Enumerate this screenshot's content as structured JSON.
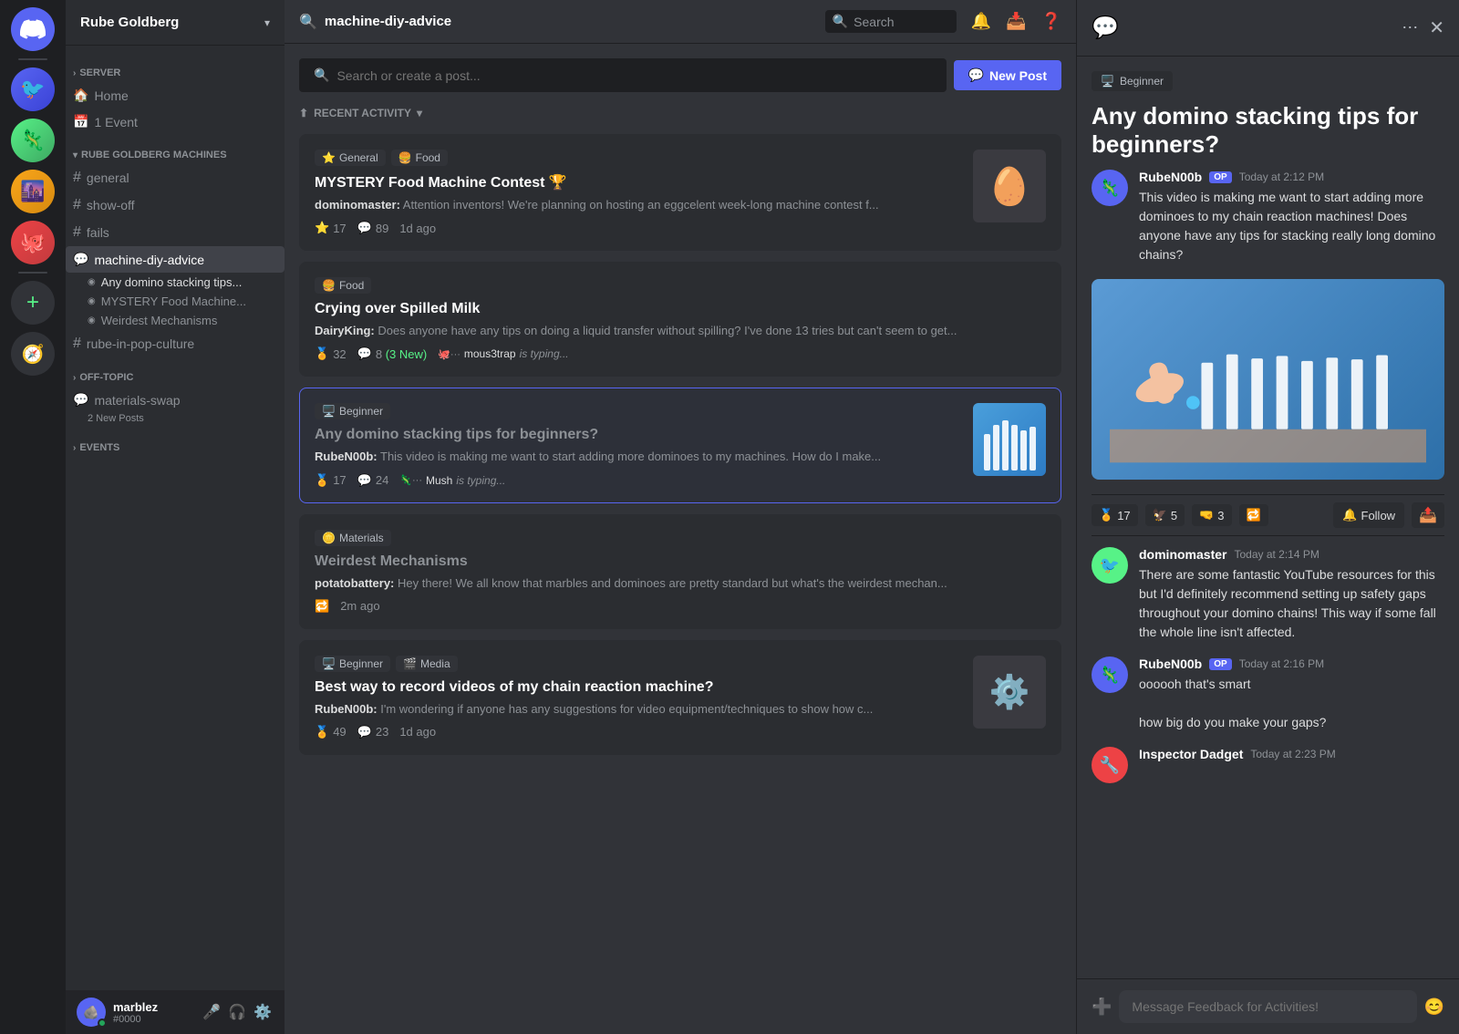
{
  "app": {
    "server_name": "Rube Goldberg",
    "channel_name": "machine-diy-advice"
  },
  "icon_bar": {
    "discord_icon": "💬",
    "add_server_icon": "+",
    "compass_icon": "🧭",
    "servers": [
      {
        "emoji": "🐦",
        "color": "#5865f2"
      },
      {
        "emoji": "🦎",
        "color": "#57f287"
      },
      {
        "emoji": "🌆",
        "color": "#faa61a"
      },
      {
        "emoji": "🐙",
        "color": "#ed4245"
      }
    ]
  },
  "sidebar": {
    "server_name": "Rube Goldberg",
    "sections": {
      "server_label": "SERVER",
      "items": [
        {
          "icon": "🏠",
          "label": "Home",
          "type": "nav"
        },
        {
          "icon": "📅",
          "label": "1 Event",
          "type": "nav"
        }
      ]
    },
    "category_machines": "RUBE GOLDBERG MACHINES",
    "channels": [
      {
        "name": "general",
        "type": "hash"
      },
      {
        "name": "show-off",
        "type": "hash"
      },
      {
        "name": "fails",
        "type": "hash"
      },
      {
        "name": "machine-diy-advice",
        "type": "bubble",
        "active": true
      }
    ],
    "sub_channels": [
      {
        "name": "Any domino stacking tips...",
        "active": true
      },
      {
        "name": "MYSTERY Food Machine...",
        "active": false
      },
      {
        "name": "Weirdest Mechanisms",
        "active": false
      }
    ],
    "extra_channels": [
      {
        "name": "rube-in-pop-culture",
        "type": "hash"
      }
    ],
    "category_offtopic": "OFF-TOPIC",
    "materials_swap": "materials-swap",
    "materials_new_posts": "2 New Posts",
    "category_events": "EVENTS"
  },
  "header": {
    "channel_name": "machine-diy-advice",
    "search_placeholder": "Search",
    "buttons": [
      "🔔",
      "📺",
      "❓",
      "⋯",
      "✕"
    ]
  },
  "forum": {
    "search_placeholder": "Search or create a post...",
    "new_post_label": "New Post",
    "new_post_icon": "💬",
    "recent_activity_label": "RECENT ACTIVITY",
    "sort_icon": "↕",
    "posts": [
      {
        "id": 1,
        "tags": [
          {
            "emoji": "⭐",
            "label": "General"
          },
          {
            "emoji": "🍔",
            "label": "Food"
          }
        ],
        "title": "MYSTERY Food Machine Contest 🏆",
        "author": "dominomaster",
        "preview": "Attention inventors! We're planning on hosting an eggcelent week-long machine contest f...",
        "stars": 17,
        "comments": 89,
        "time": "1d ago",
        "has_thumb": true,
        "thumb_type": "egg"
      },
      {
        "id": 2,
        "tags": [
          {
            "emoji": "🍔",
            "label": "Food"
          }
        ],
        "title": "Crying over Spilled Milk",
        "author": "DairyKing",
        "preview": "Does anyone have any tips on doing a liquid transfer without spilling? I've done 13 tries but can't seem to get...",
        "reactions": 32,
        "comments": 8,
        "new_comments": "3 New",
        "typing": "mous3trap",
        "is_typing": true,
        "has_thumb": false
      },
      {
        "id": 3,
        "tags": [
          {
            "emoji": "🖥️",
            "label": "Beginner"
          }
        ],
        "title": "Any domino stacking tips for beginners?",
        "author": "RubeN00b",
        "preview": "This video is making me want to start adding more dominoes to my machines. How do I make...",
        "reactions": 17,
        "comments": 24,
        "typing": "Mush",
        "is_typing": true,
        "has_thumb": true,
        "thumb_type": "domino",
        "selected": true
      },
      {
        "id": 4,
        "tags": [
          {
            "emoji": "🪙",
            "label": "Materials"
          }
        ],
        "title": "Weirdest Mechanisms",
        "author": "potatobattery",
        "preview": "Hey there! We all know that marbles and dominoes are pretty standard but what's the weirdest mechan...",
        "time": "2m ago",
        "has_thumb": false,
        "muted": true
      },
      {
        "id": 5,
        "tags": [
          {
            "emoji": "🖥️",
            "label": "Beginner"
          },
          {
            "emoji": "🎬",
            "label": "Media"
          }
        ],
        "title": "Best way to record videos of my chain reaction machine?",
        "author": "RubeN00b",
        "preview": "I'm wondering if anyone has any suggestions for video equipment/techniques to show how c...",
        "reactions": 49,
        "comments": 23,
        "time": "1d ago",
        "has_thumb": true,
        "thumb_type": "gear"
      }
    ]
  },
  "right_panel": {
    "post_title": "Any domino stacking tips for beginners?",
    "tag": "Beginner",
    "tag_emoji": "🖥️",
    "post_icon": "💬",
    "comments": [
      {
        "author": "RubeN00b",
        "op_badge": "OP",
        "time": "Today at 2:12 PM",
        "text": "This video is making me want to start adding more dominoes to my chain reaction machines! Does anyone have any tips for stacking really long domino chains?",
        "avatar_color": "#5865f2",
        "avatar_emoji": "🦎"
      },
      {
        "author": "dominomaster",
        "time": "Today at 2:14 PM",
        "text": "There are some fantastic YouTube resources for this but I'd definitely recommend setting up safety gaps throughout your domino chains! This way if some fall the whole line isn't affected.",
        "avatar_color": "#57f287",
        "avatar_emoji": "🐦"
      },
      {
        "author": "RubeN00b",
        "op_badge": "OP",
        "time": "Today at 2:16 PM",
        "text": "oooooh that's smart\n\nhow big do you make your gaps?",
        "avatar_color": "#5865f2",
        "avatar_emoji": "🦎"
      },
      {
        "author": "Inspector Dadget",
        "time": "Today at 2:23 PM",
        "text": "",
        "avatar_color": "#ed4245",
        "avatar_emoji": "🔧"
      }
    ],
    "reactions": [
      {
        "emoji": "🏅",
        "count": 17
      },
      {
        "emoji": "🦅",
        "count": 5
      },
      {
        "emoji": "🤜",
        "count": 3
      },
      {
        "emoji": "🔁",
        "count": ""
      }
    ],
    "follow_label": "Follow",
    "share_icon": "📤",
    "message_placeholder": "Message Feedback for Activities!",
    "emoji_icon": "😊",
    "plus_icon": "+"
  },
  "user": {
    "name": "marblez",
    "tag": "#0000",
    "avatar_emoji": "🪨",
    "avatar_color": "#5865f2",
    "status": "online"
  }
}
